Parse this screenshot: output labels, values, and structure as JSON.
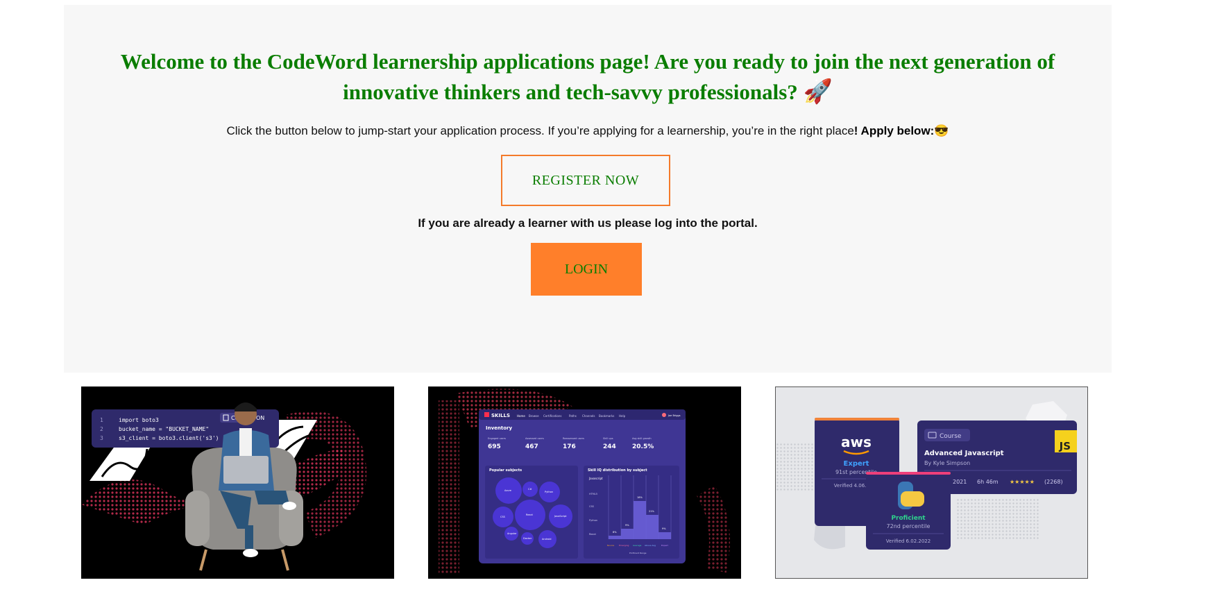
{
  "hero": {
    "title": "Welcome to the CodeWord learnership applications page! Are you ready to join the next generation of innovative thinkers and tech-savvy professionals?",
    "title_emoji": "🚀",
    "intro_text": "Click the button below to jump-start your application process. If you’re applying for a learnership, you’re in the right place",
    "intro_bold": "! Apply below:",
    "intro_emoji": "😎",
    "register_label": "REGISTER NOW",
    "already_learner_text": "If you are already a learner with us please log into the portal.",
    "login_label": "LOGIN"
  },
  "card1": {
    "code_lines": [
      {
        "num": "1",
        "text": "import boto3"
      },
      {
        "num": "2",
        "text": "bucket_name = \"BUCKET_NAME\""
      },
      {
        "num": "3",
        "text": "s3_client = boto3.client('s3')"
      }
    ],
    "copy_label": "Copy",
    "copy_suffix": "ON"
  },
  "card2": {
    "brand": "SKILLS",
    "nav_items": [
      "Home",
      "Browse",
      "Certifications",
      "Paths",
      "Channels",
      "Bookmarks",
      "Help"
    ],
    "user": "Joe Briggs",
    "section_title": "Inventory",
    "stats": [
      {
        "label": "Engaged users",
        "value": "695"
      },
      {
        "label": "Assessed users",
        "value": "467"
      },
      {
        "label": "Reassessed users",
        "value": "176"
      },
      {
        "label": "Skill ups",
        "value": "244"
      },
      {
        "label": "Avg skill growth",
        "value": "20.5%"
      }
    ],
    "popular_title": "Popular subjects",
    "bubbles": [
      "Azure",
      "C#",
      "Python",
      "CSS",
      "React",
      "JavaScript",
      "Angular",
      "Docker",
      "Android"
    ],
    "distribution_title": "Skill IQ distribution by subject",
    "distribution_subject": "Javascript",
    "distribution_rows": [
      "HTML5",
      "CSS",
      "Python",
      "React"
    ],
    "bar_labels": [
      "8%",
      "9%",
      "18%",
      "21%",
      "9%"
    ],
    "legend": [
      "Novice",
      "Emerging",
      "Average",
      "Above Avg",
      "Expert"
    ],
    "axis_label": "Proficient Range"
  },
  "card3": {
    "aws_brand": "aws",
    "aws_level": "Expert",
    "aws_percentile": "91st percentile",
    "aws_verified": "Verified 4.06.2021",
    "course_tag": "Course",
    "course_title": "Advanced Javascript",
    "course_author": "By Kyle Simpson",
    "course_meta_date": "2021",
    "course_duration": "6h 46m",
    "course_rating_stars": "★★★★★",
    "course_rating_count": "(2268)",
    "js_badge": "JS",
    "python_level": "Proficient",
    "python_percentile": "72nd percentile",
    "python_verified": "Verified 6.02.2022"
  },
  "colors": {
    "title_green": "#0a7d00",
    "accent_orange": "#ff7f2a",
    "hero_bg": "#f7f7f7",
    "card_purple": "#2f2a6b",
    "bubble_blue": "#4a35d4"
  }
}
